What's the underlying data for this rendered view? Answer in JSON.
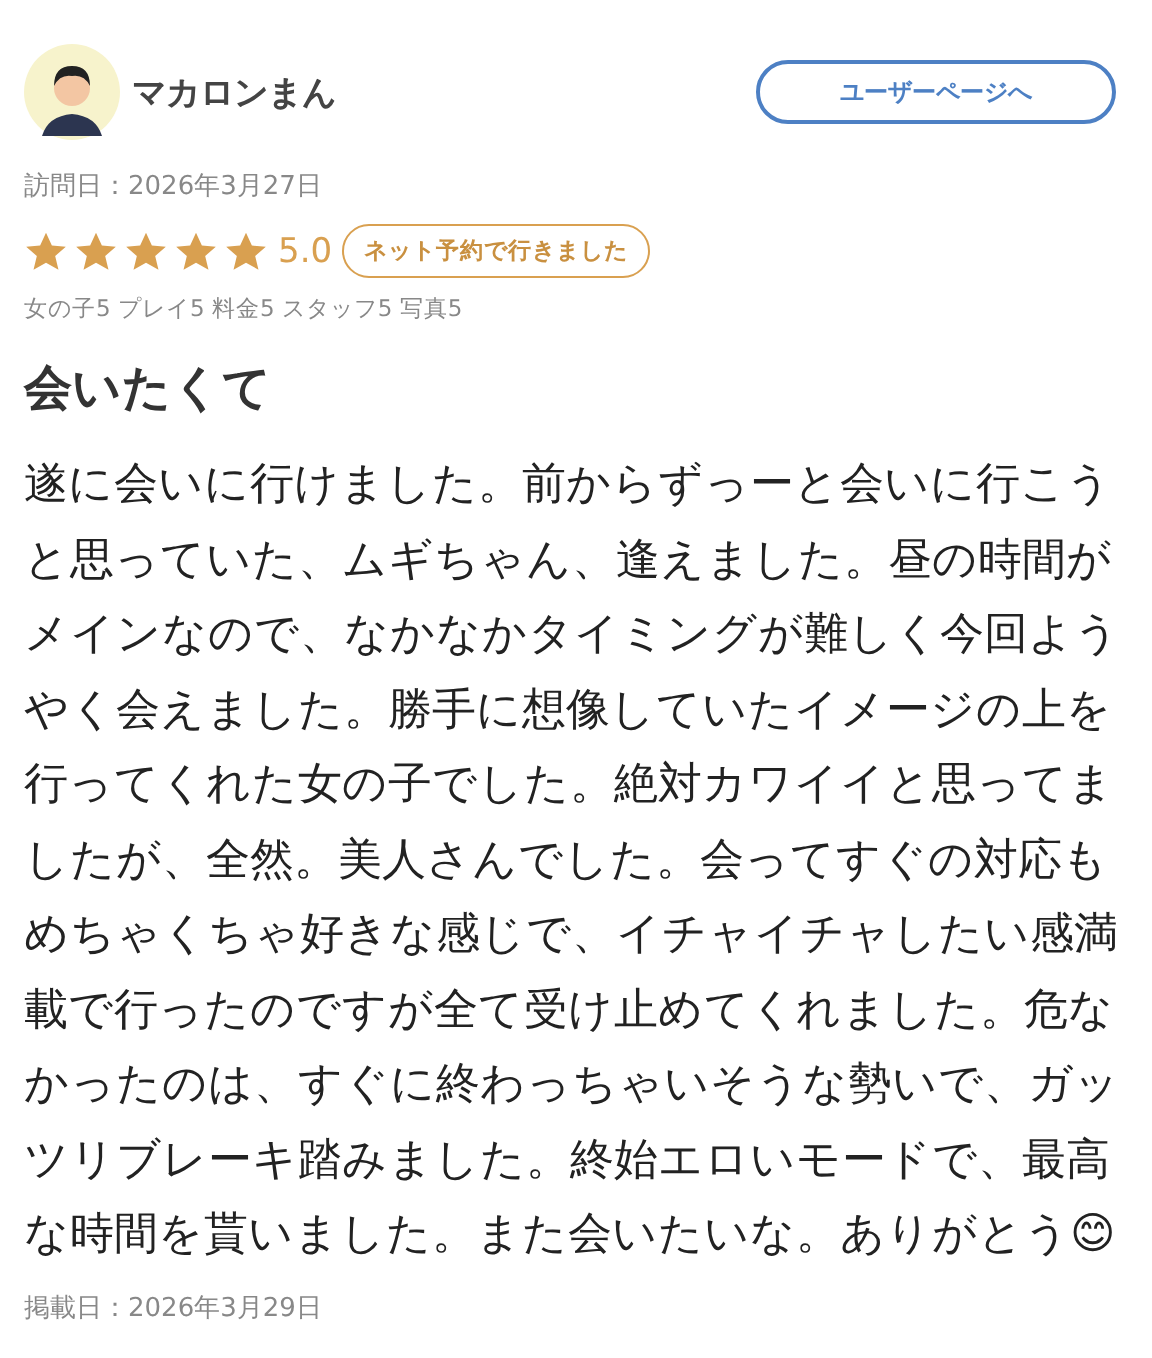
{
  "reviewer": {
    "name": "マカロンまん",
    "user_page_button": "ユーザーページへ"
  },
  "visit_date": "訪問日：2026年3月27日",
  "rating": {
    "stars": 5,
    "score": "5.0",
    "badge": "ネット予約で行きました"
  },
  "sub_ratings": "女の子5 プレイ5 料金5 スタッフ5 写真5",
  "title": "会いたくて",
  "body": "遂に会いに行けました。前からずっーと会いに行こうと思っていた、ムギちゃん、逢えました。昼の時間がメインなので、なかなかタイミングが難しく今回ようやく会えました。勝手に想像していたイメージの上を行ってくれた女の子でした。絶対カワイイと思ってましたが、全然。美人さんでした。会ってすぐの対応もめちゃくちゃ好きな感じで、イチャイチャしたい感満載で行ったのですが全て受け止めてくれました。危なかったのは、すぐに終わっちゃいそうな勢いで、ガッツリブレーキ踏みました。終始エロいモードで、最高な時間を貰いました。また会いたいな。ありがとう😊",
  "posted_date": "掲載日：2026年3月29日"
}
